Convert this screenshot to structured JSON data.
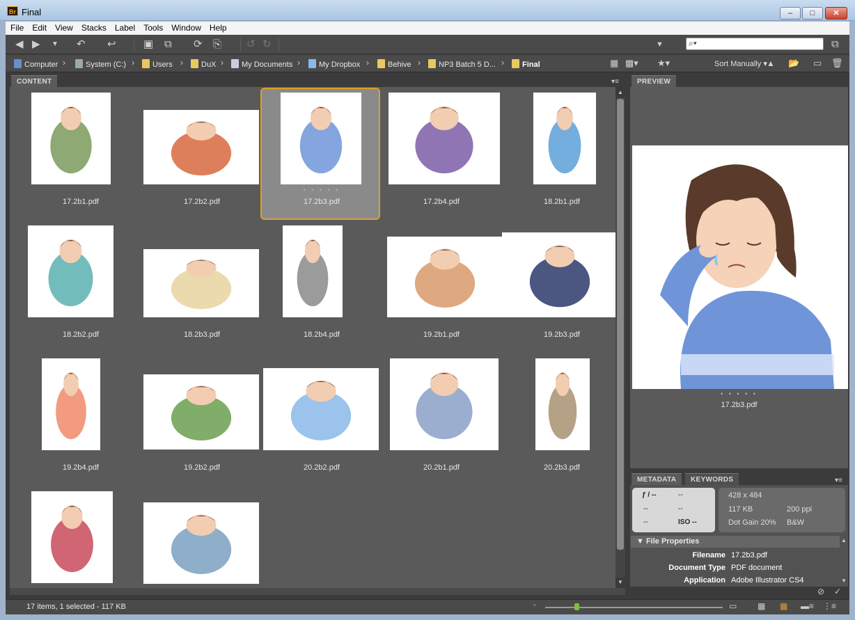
{
  "window": {
    "title": "Final",
    "app_icon": "Br",
    "buttons": {
      "minimize": "–",
      "maximize": "□",
      "close": "✕"
    }
  },
  "menu": [
    "File",
    "Edit",
    "View",
    "Stacks",
    "Label",
    "Tools",
    "Window",
    "Help"
  ],
  "breadcrumb": {
    "items": [
      {
        "label": "Computer",
        "icon": "computer-icon"
      },
      {
        "label": "System (C:)",
        "icon": "drive-icon"
      },
      {
        "label": "Users",
        "icon": "folder-icon"
      },
      {
        "label": "DuX",
        "icon": "folder-icon"
      },
      {
        "label": "My Documents",
        "icon": "documents-icon"
      },
      {
        "label": "My Dropbox",
        "icon": "dropbox-folder-icon"
      },
      {
        "label": "Behive",
        "icon": "folder-icon"
      },
      {
        "label": "NP3 Batch 5 D...",
        "icon": "folder-icon"
      },
      {
        "label": "Final",
        "icon": "folder-icon"
      }
    ],
    "sort": "Sort Manually"
  },
  "panels": {
    "content_tab": "CONTENT",
    "preview_tab": "PREVIEW",
    "metadata_tab": "METADATA",
    "keywords_tab": "KEYWORDS"
  },
  "files": [
    "17.2b1.pdf",
    "17.2b2.pdf",
    "17.2b3.pdf",
    "17.2b4.pdf",
    "18.2b1.pdf",
    "18.2b2.pdf",
    "18.2b3.pdf",
    "18.2b4.pdf",
    "19.2b1.pdf",
    "19.2b3.pdf",
    "19.2b4.pdf",
    "19.2b2.pdf",
    "20.2b2.pdf",
    "20.2b1.pdf",
    "20.2b3.pdf",
    "",
    ""
  ],
  "selected_index": 2,
  "preview": {
    "filename": "17.2b3.pdf"
  },
  "metadata": {
    "camera": {
      "aperture": "ƒ / --",
      "shutter": "--",
      "r2c1": "--",
      "r2c2": "--",
      "r3c1": "--",
      "iso": "ISO --"
    },
    "info": {
      "dimensions": "428 x 484",
      "size": "117 KB",
      "resolution": "200 ppi",
      "color": "Dot Gain 20%",
      "mode": "B&W"
    },
    "file_properties_label": "File Properties",
    "fields": [
      {
        "key": "Filename",
        "value": "17.2b3.pdf"
      },
      {
        "key": "Document Type",
        "value": "PDF document"
      },
      {
        "key": "Application",
        "value": "Adobe Illustrator CS4"
      }
    ]
  },
  "status": {
    "text": "17 items, 1 selected - 117 KB"
  },
  "colors": {
    "selection_border": "#d9a12a",
    "panel_bg": "#5a5a5a",
    "chrome_dark": "#4a4a4a"
  }
}
